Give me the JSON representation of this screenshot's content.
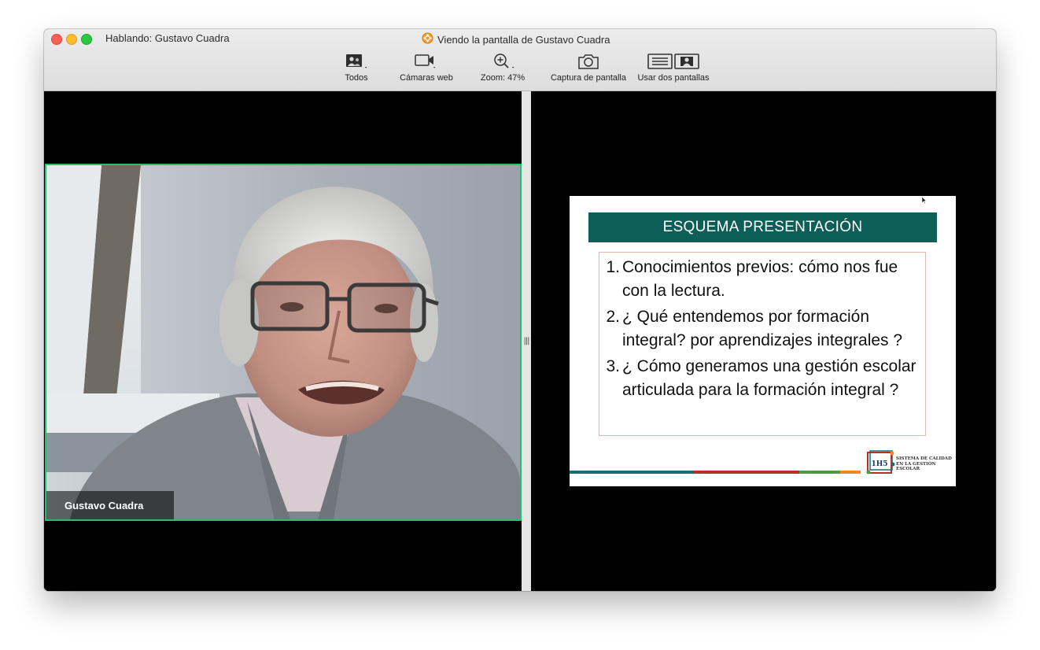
{
  "window": {
    "speaking_label": "Hablando: Gustavo Cuadra",
    "title": "Viendo la pantalla de Gustavo Cuadra"
  },
  "toolbar": {
    "items": [
      {
        "label": "Todos",
        "icon": "gallery-view-icon"
      },
      {
        "label": "Cámaras web",
        "icon": "video-camera-icon"
      },
      {
        "label": "Zoom: 47%",
        "icon": "zoom-in-icon"
      },
      {
        "label": "Captura de pantalla",
        "icon": "camera-icon"
      },
      {
        "label": "Usar dos pantallas",
        "icon": "dual-screens-icon"
      }
    ]
  },
  "participant": {
    "name": "Gustavo Cuadra",
    "active_speaker_color": "#22c16b"
  },
  "slide": {
    "title": "ESQUEMA  PRESENTACIÓN",
    "header_color": "#0d5e57",
    "items": [
      {
        "num": "1.",
        "text": "Conocimientos previos: cómo nos fue con la lectura."
      },
      {
        "num": "2.",
        "text": "¿ Qué entendemos por formación integral? por aprendizajes integrales ?"
      },
      {
        "num": "3.",
        "text": "¿ Cómo generamos una gestión escolar articulada para la formación integral ?"
      }
    ],
    "logo": {
      "mark": "1H5",
      "lines": [
        "SISTEMA DE CALIDAD",
        "EN LA GESTIÓN",
        "ESCOLAR"
      ]
    }
  }
}
